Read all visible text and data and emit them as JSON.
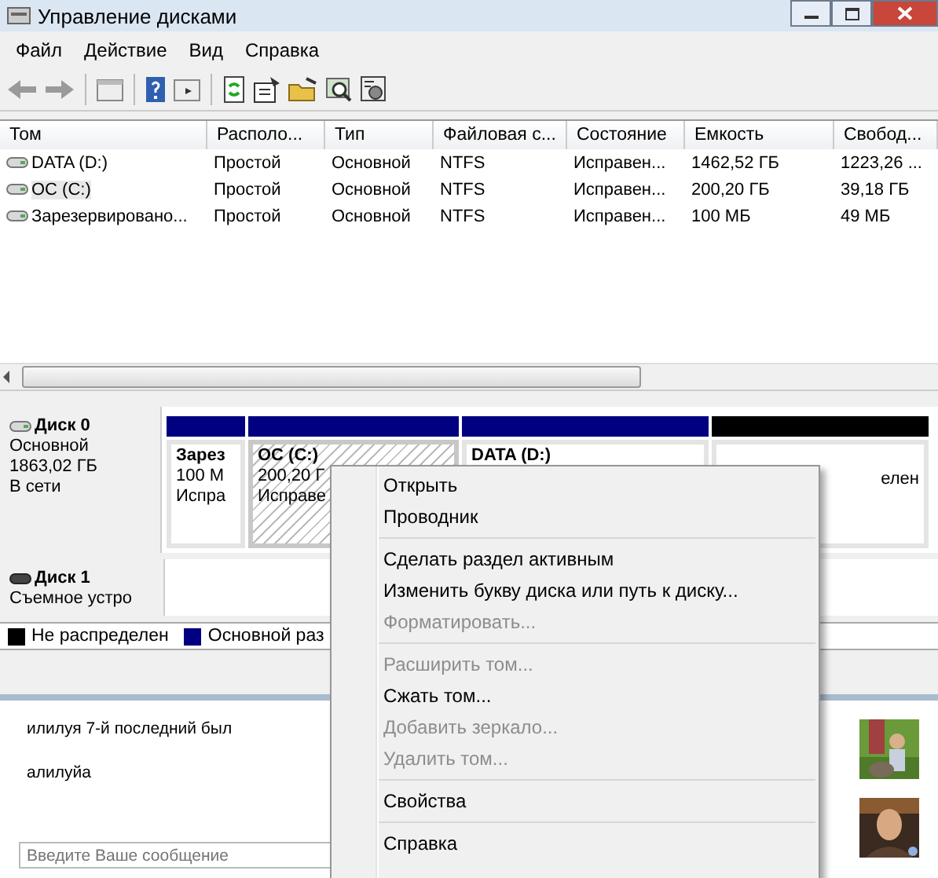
{
  "window": {
    "title": "Управление дисками"
  },
  "menu": [
    "Файл",
    "Действие",
    "Вид",
    "Справка"
  ],
  "table": {
    "columns": [
      "Том",
      "Располо...",
      "Тип",
      "Файловая с...",
      "Состояние",
      "Емкость",
      "Свобод..."
    ],
    "rows": [
      {
        "selected": false,
        "cells": [
          "DATA (D:)",
          "Простой",
          "Основной",
          "NTFS",
          "Исправен...",
          "1462,52 ГБ",
          "1223,26 ..."
        ]
      },
      {
        "selected": true,
        "cells": [
          "ОС (C:)",
          "Простой",
          "Основной",
          "NTFS",
          "Исправен...",
          "200,20 ГБ",
          "39,18 ГБ"
        ]
      },
      {
        "selected": false,
        "cells": [
          "Зарезервировано...",
          "Простой",
          "Основной",
          "NTFS",
          "Исправен...",
          "100 МБ",
          "49 МБ"
        ]
      }
    ]
  },
  "disks": [
    {
      "name": "Диск 0",
      "lines": [
        "Основной",
        "1863,02 ГБ",
        "В сети"
      ],
      "partitions": [
        {
          "kind": "primary",
          "selected": false,
          "lines": [
            "Зарез",
            "100 М",
            "Испра"
          ]
        },
        {
          "kind": "primary",
          "selected": true,
          "lines": [
            "ОС (C:)",
            "200,20 Г",
            "Исправе"
          ]
        },
        {
          "kind": "primary",
          "selected": false,
          "lines": [
            "DATA (D:)"
          ]
        },
        {
          "kind": "unallocated",
          "selected": false,
          "lines": [
            "елен"
          ]
        }
      ]
    },
    {
      "name": "Диск 1",
      "lines": [
        "Съемное устро"
      ]
    }
  ],
  "legend": [
    {
      "label": "Не распределен",
      "color": "#000000"
    },
    {
      "label": "Основной раз",
      "color": "#000080"
    }
  ],
  "chat": {
    "messages": [
      "илилуя 7-й последний был",
      "алилуйа"
    ],
    "input": {
      "placeholder": "Введите Ваше сообщение"
    }
  },
  "context_menu": [
    {
      "kind": "item",
      "label": "Открыть",
      "disabled": false
    },
    {
      "kind": "item",
      "label": "Проводник",
      "disabled": false
    },
    {
      "kind": "separator"
    },
    {
      "kind": "item",
      "label": "Сделать раздел активным",
      "disabled": false
    },
    {
      "kind": "item",
      "label": "Изменить букву диска или путь к диску...",
      "disabled": false
    },
    {
      "kind": "item",
      "label": "Форматировать...",
      "disabled": true
    },
    {
      "kind": "separator"
    },
    {
      "kind": "item",
      "label": "Расширить том...",
      "disabled": true
    },
    {
      "kind": "item",
      "label": "Сжать том...",
      "disabled": false
    },
    {
      "kind": "item",
      "label": "Добавить зеркало...",
      "disabled": true
    },
    {
      "kind": "item",
      "label": "Удалить том...",
      "disabled": true
    },
    {
      "kind": "separator"
    },
    {
      "kind": "item",
      "label": "Свойства",
      "disabled": false
    },
    {
      "kind": "separator"
    },
    {
      "kind": "item",
      "label": "Справка",
      "disabled": false
    }
  ]
}
